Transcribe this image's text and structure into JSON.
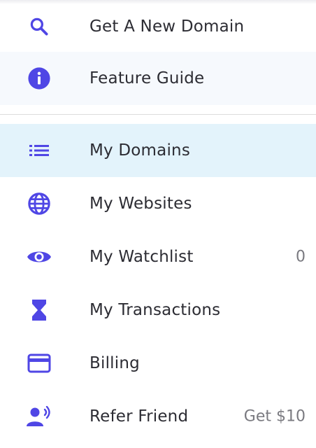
{
  "accent_color": "#4f46e5",
  "menu": {
    "items": [
      {
        "label": "Get A New Domain",
        "icon": "search-icon",
        "meta": ""
      },
      {
        "label": "Feature Guide",
        "icon": "info-icon",
        "meta": ""
      },
      {
        "label": "My Domains",
        "icon": "list-icon",
        "meta": "",
        "active": true
      },
      {
        "label": "My Websites",
        "icon": "globe-icon",
        "meta": ""
      },
      {
        "label": "My Watchlist",
        "icon": "eye-icon",
        "meta": "0"
      },
      {
        "label": "My Transactions",
        "icon": "hourglass-icon",
        "meta": ""
      },
      {
        "label": "Billing",
        "icon": "credit-card-icon",
        "meta": ""
      },
      {
        "label": "Refer Friend",
        "icon": "refer-friend-icon",
        "meta": "Get $10"
      }
    ]
  }
}
